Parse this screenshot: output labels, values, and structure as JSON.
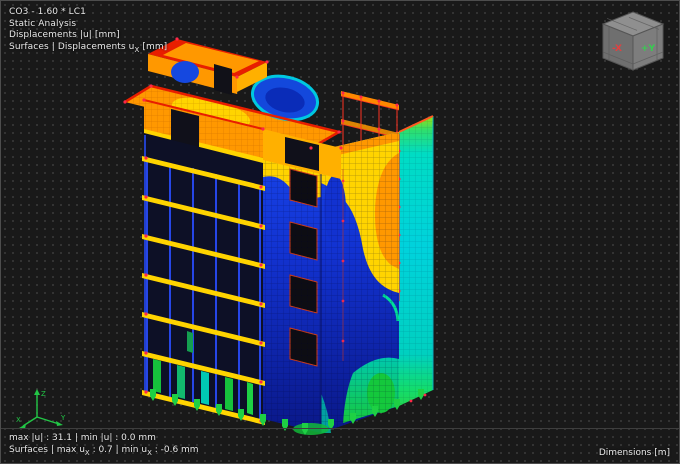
{
  "header": {
    "load_combination": "CO3 - 1.60 * LC1",
    "analysis_type": "Static Analysis",
    "result_type": "Displacements |u| [mm]",
    "surface_result": {
      "prefix": "Surfaces | Displacements u",
      "sub": "X",
      "suffix": " [mm]"
    }
  },
  "footer": {
    "max_min": "max |u| : 31.1 | min |u| : 0.0 mm",
    "surface_line": {
      "p1": "Surfaces | max u",
      "s1": "X",
      "p2": " : 0.7 | min u",
      "s2": "X",
      "p3": " : -0.6 mm"
    },
    "dimensions": "Dimensions [m]"
  },
  "view_cube": {
    "face_left": "-X",
    "face_right": "+Y"
  },
  "axis_triad": {
    "x": "X",
    "y": "Y",
    "z": "Z"
  },
  "legend_colors": {
    "max_displacement": "#e81e00",
    "high_displacement": "#ff9800",
    "mid_displacement": "#ffd400",
    "low_displacement": "#1232d0",
    "surface_min": "#00d2dc",
    "support_green": "#1ed044"
  }
}
